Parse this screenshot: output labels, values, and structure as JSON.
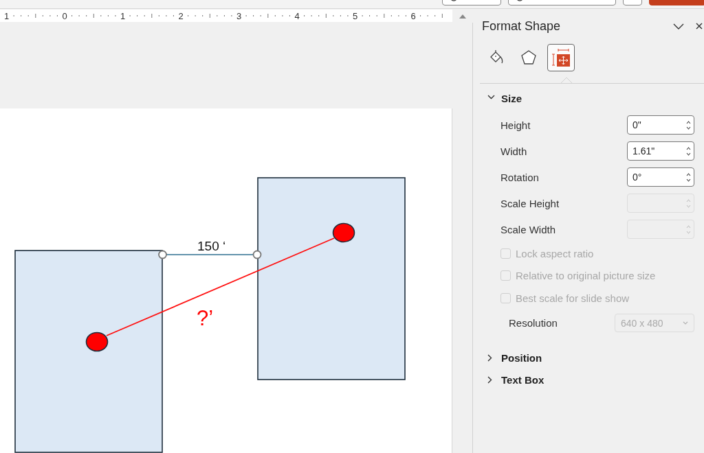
{
  "top_bar": {
    "buttons": [
      {
        "kind": "record"
      },
      {
        "kind": "teams"
      },
      {
        "kind": "plain"
      },
      {
        "kind": "primary"
      }
    ]
  },
  "ruler": {
    "labels": [
      "1",
      "0",
      "1",
      "2",
      "3",
      "4",
      "5",
      "6"
    ]
  },
  "slide": {
    "dimension_label": "150 ‘",
    "question_label": "?’"
  },
  "format_pane": {
    "title": "Format Shape",
    "tabs": [
      {
        "kind": "fill",
        "selected": false
      },
      {
        "kind": "effects",
        "selected": false
      },
      {
        "kind": "size",
        "selected": true
      }
    ],
    "sections": [
      {
        "title": "Size",
        "expanded": true,
        "rows": [
          {
            "kind": "spin",
            "label": "Height",
            "value": "0\"",
            "disabled": false
          },
          {
            "kind": "spin",
            "label": "Width",
            "value": "1.61\"",
            "disabled": false
          },
          {
            "kind": "spin",
            "label": "Rotation",
            "value": "0°",
            "disabled": false
          },
          {
            "kind": "spin",
            "label": "Scale Height",
            "disabled": true
          },
          {
            "kind": "spin",
            "label": "Scale Width",
            "disabled": true
          },
          {
            "kind": "check",
            "label": "Lock aspect ratio",
            "checked": false,
            "disabled": true
          },
          {
            "kind": "check",
            "label": "Relative to original picture size",
            "checked": false,
            "disabled": true
          },
          {
            "kind": "check",
            "label": "Best scale for slide show",
            "checked": false,
            "disabled": true
          },
          {
            "kind": "select",
            "label": "Resolution",
            "value": "640 x 480",
            "disabled": true
          }
        ]
      },
      {
        "title": "Position",
        "expanded": false
      },
      {
        "title": "Text Box",
        "expanded": false
      }
    ]
  }
}
